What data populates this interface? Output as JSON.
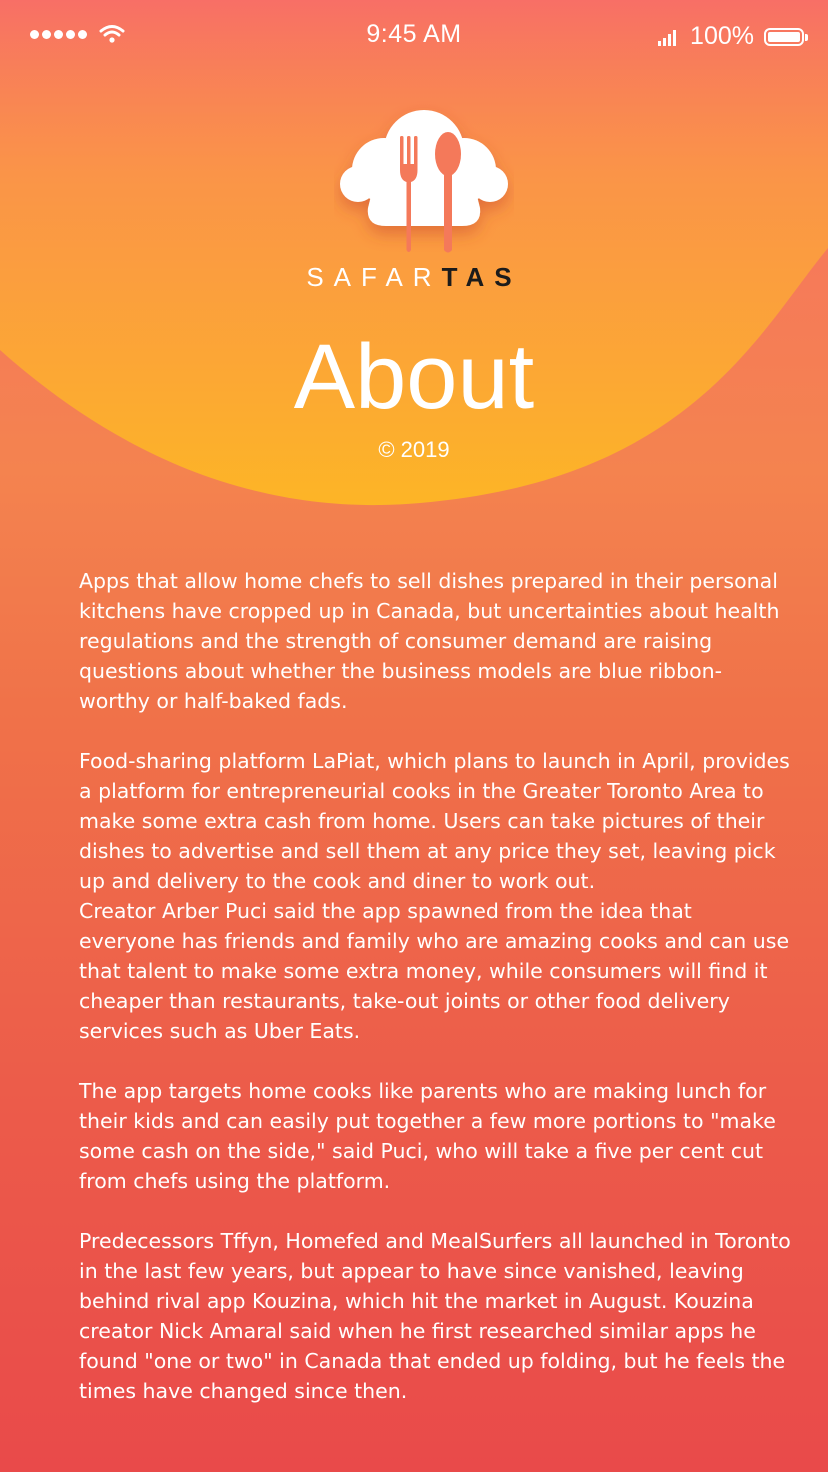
{
  "status_bar": {
    "time": "9:45 AM",
    "battery": "100%",
    "battery_level": 1.0
  },
  "brand": {
    "name_light": "SAFAR",
    "name_dark": "TAS",
    "logo_icon": "chef-hat-fork-spoon-icon"
  },
  "header": {
    "title": "About",
    "copyright": "© 2019"
  },
  "colors": {
    "gradient_top": "#f86f66",
    "gradient_bottom": "#e94a4a",
    "wave_top": "#fb9a44",
    "wave_bottom": "#fdb526",
    "logo_cutout": "#f4795a",
    "brand_dark": "#1b1b1b"
  },
  "article": {
    "paragraphs": [
      "Apps that allow home chefs to sell dishes prepared in their personal kitchens have cropped up in Canada, but uncertainties about health regulations and the strength of consumer demand are raising questions about whether the business models are blue ribbon-worthy or half-baked fads.",
      "Food-sharing platform LaPiat, which plans to launch in April, provides a platform for entrepreneurial cooks in the Greater Toronto Area to make some extra cash from home. Users can take pictures of their dishes to advertise and sell them at any price they set, leaving pick up and delivery to the cook and diner to work out.",
      "Creator Arber Puci said the app spawned from the idea that everyone has friends and family who are amazing cooks and can use that talent to make some extra money, while consumers will find it cheaper than restaurants, take-out joints or other food delivery services such as Uber Eats.",
      "The app targets home cooks like parents who are making lunch for their kids and can easily put together a few more portions to \"make some cash on the side,\" said Puci, who will take a five per cent cut from chefs using the platform.",
      "Predecessors Tffyn, Homefed and MealSurfers all launched in Toronto in the last few years, but appear to have since vanished, leaving behind rival app Kouzina, which hit the market in August. Kouzina creator Nick Amaral said when he first researched similar apps he found \"one or two\" in Canada that ended up folding, but he feels the times have changed since then."
    ]
  }
}
